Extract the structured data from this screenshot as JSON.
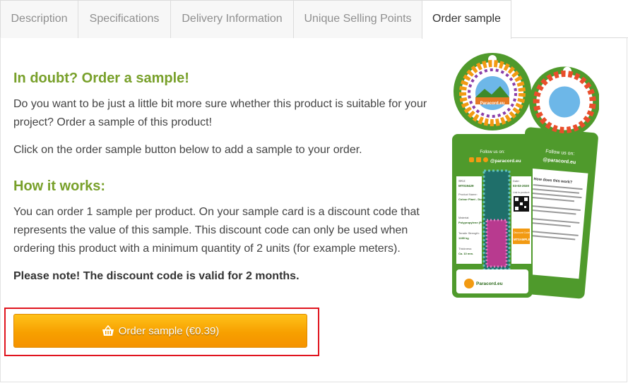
{
  "tabs": [
    {
      "label": "Description"
    },
    {
      "label": "Specifications"
    },
    {
      "label": "Delivery Information"
    },
    {
      "label": "Unique Selling Points"
    },
    {
      "label": "Order sample"
    }
  ],
  "content": {
    "heading1": "In doubt? Order a sample!",
    "p1": "Do you want to be just a little bit more sure whether this product is suitable for your project? Order a sample of this product!",
    "p2": "Click on the order sample button below to add a sample to your order.",
    "heading2": "How it works:",
    "p3": "You can order 1 sample per product. On your sample card is a discount code that represents the value of this sample. This discount code can only be used when ordering this product with a minimum quantity of 2 units (for example meters).",
    "note": "Please note! The discount code is valid for 2 months.",
    "order_button": "Order sample (€0.39)"
  },
  "sample_card": {
    "brand": "Paracord.eu",
    "follow": "Follow us on:",
    "handle": "@paracord.eu",
    "sku_label": "SKU:",
    "sku": "MT019429",
    "product_label": "Product Name:",
    "product": "Colour Plant - Dog Leash Rope - Ø 10mm",
    "material_label": "Material:",
    "material": "Polypropylene (PP)",
    "tensile_label": "Tensile Strength:",
    "tensile": "1285 kg",
    "thickness_label": "Thickness:",
    "thickness": "Ca. 10 mm.",
    "date_label": "Date:",
    "date": "03-03-2020",
    "link_label": "Link to product:",
    "discount_label": "Discount Code:",
    "discount_code": "MTSAMPLE",
    "back_heading": "How does this work?",
    "colors": {
      "green": "#4f9a2c",
      "dark_green": "#2e6b1e",
      "orange": "#f29a12",
      "tab_text": "#8f8f8f",
      "heading": "#78a02a",
      "button": "#f7a000",
      "highlight": "#e0141e"
    }
  },
  "icons": {
    "basket": "basket-icon",
    "instagram": "instagram-icon",
    "facebook": "facebook-icon",
    "pinterest": "pinterest-icon",
    "qr": "qr-code-icon"
  }
}
